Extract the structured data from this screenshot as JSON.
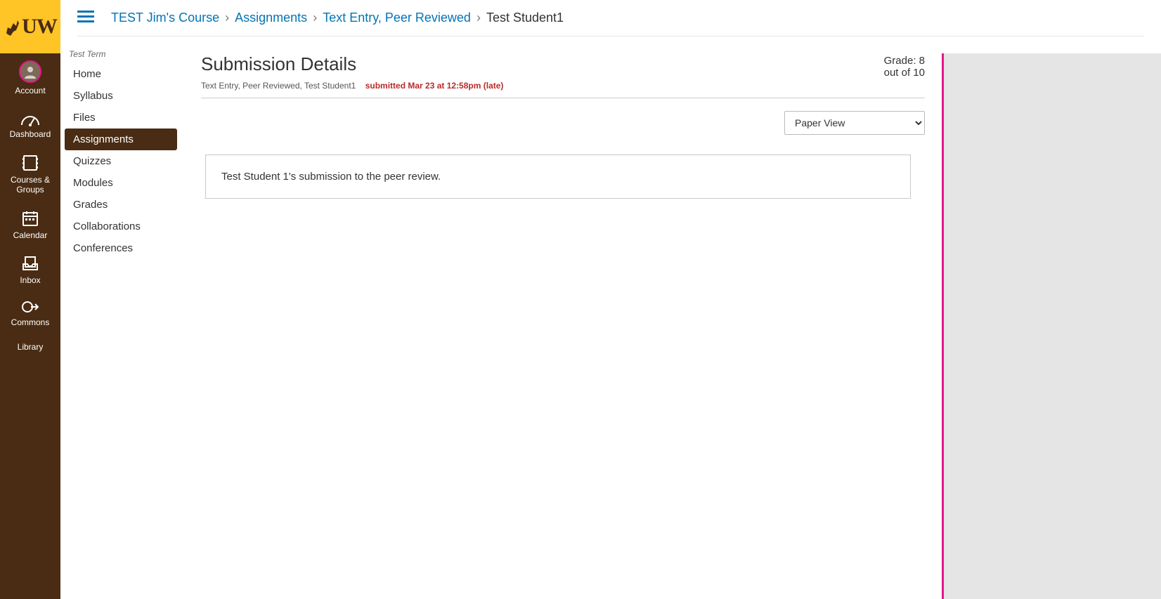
{
  "globalNav": {
    "items": [
      {
        "label": "Account"
      },
      {
        "label": "Dashboard"
      },
      {
        "label": "Courses & Groups"
      },
      {
        "label": "Calendar"
      },
      {
        "label": "Inbox"
      },
      {
        "label": "Commons"
      },
      {
        "label": "Library"
      }
    ]
  },
  "breadcrumb": {
    "crumbs": [
      {
        "label": "TEST Jim's Course"
      },
      {
        "label": "Assignments"
      },
      {
        "label": "Text Entry, Peer Reviewed"
      }
    ],
    "current": "Test Student1",
    "separator": "›"
  },
  "courseNav": {
    "termLabel": "Test Term",
    "items": [
      {
        "label": "Home"
      },
      {
        "label": "Syllabus"
      },
      {
        "label": "Files"
      },
      {
        "label": "Assignments",
        "active": true
      },
      {
        "label": "Quizzes"
      },
      {
        "label": "Modules"
      },
      {
        "label": "Grades"
      },
      {
        "label": "Collaborations"
      },
      {
        "label": "Conferences"
      }
    ]
  },
  "page": {
    "title": "Submission Details",
    "subInfo": "Text Entry, Peer Reviewed, Test Student1",
    "submittedText": "submitted Mar 23 at 12:58pm (late)",
    "gradeLine1": "Grade: 8",
    "gradeLine2": "out of 10",
    "viewSelect": {
      "selected": "Paper View",
      "options": [
        "Paper View"
      ]
    },
    "submissionBody": "Test Student 1's submission to the peer review."
  },
  "colors": {
    "brandBrown": "#492c13",
    "brandGold": "#ffc425",
    "link": "#0374b5",
    "accentPink": "#e6158a",
    "lateRed": "#b82b28"
  }
}
